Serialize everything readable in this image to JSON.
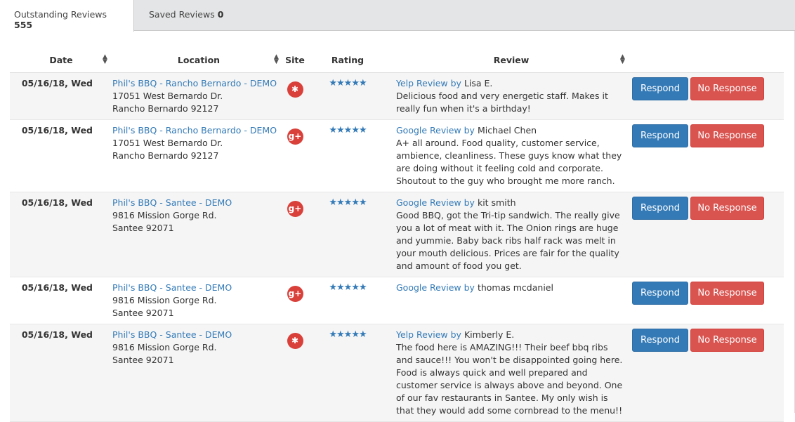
{
  "tabs": [
    {
      "label": "Outstanding Reviews",
      "count": "555"
    },
    {
      "label": "Saved Reviews",
      "count": "0"
    }
  ],
  "columns": {
    "date": "Date",
    "location": "Location",
    "site": "Site",
    "rating": "Rating",
    "review": "Review"
  },
  "buttons": {
    "respond": "Respond",
    "no_response": "No Response"
  },
  "reviews": [
    {
      "date": "05/16/18, Wed",
      "location_name": "Phil's BBQ - Rancho Bernardo - DEMO",
      "address1": "17051 West Bernardo Dr.",
      "address2": "Rancho Bernardo 92127",
      "site": "yelp",
      "rating": 5,
      "source_label": "Yelp Review by",
      "reviewer": "Lisa E.",
      "text": "Delicious food and very energetic staff. Makes it really fun when it's a birthday!"
    },
    {
      "date": "05/16/18, Wed",
      "location_name": "Phil's BBQ - Rancho Bernardo - DEMO",
      "address1": "17051 West Bernardo Dr.",
      "address2": "Rancho Bernardo 92127",
      "site": "google-plus",
      "rating": 5,
      "source_label": "Google Review by",
      "reviewer": "Michael Chen",
      "text": "A+ all around. Food quality, customer service, ambience, cleanliness. These guys know what they are doing without it feeling cold and corporate. Shoutout to the guy who brought me more ranch."
    },
    {
      "date": "05/16/18, Wed",
      "location_name": "Phil's BBQ - Santee - DEMO",
      "address1": "9816 Mission Gorge Rd.",
      "address2": "Santee 92071",
      "site": "google-plus",
      "rating": 5,
      "source_label": "Google Review by",
      "reviewer": "kit smith",
      "text": "Good BBQ, got the Tri-tip sandwich. The really give you a lot of meat with it. The Onion rings are huge and yummie. Baby back ribs half rack was melt in your mouth delicious. Prices are fair for the quality and amount of food you get."
    },
    {
      "date": "05/16/18, Wed",
      "location_name": "Phil's BBQ - Santee - DEMO",
      "address1": "9816 Mission Gorge Rd.",
      "address2": "Santee 92071",
      "site": "google-plus",
      "rating": 5,
      "source_label": "Google Review by",
      "reviewer": "thomas mcdaniel",
      "text": ""
    },
    {
      "date": "05/16/18, Wed",
      "location_name": "Phil's BBQ - Santee - DEMO",
      "address1": "9816 Mission Gorge Rd.",
      "address2": "Santee 92071",
      "site": "yelp",
      "rating": 5,
      "source_label": "Yelp Review by",
      "reviewer": "Kimberly E.",
      "text": "The food here is AMAZING!!! Their beef bbq ribs and sauce!!! You won't be disappointed going here. Food is always quick and well prepared and customer service is always above and beyond. One of our fav restaurants in Santee. My only wish is that they would add some cornbread to the menu!!"
    }
  ],
  "colors": {
    "link": "#337ab7",
    "respond": "#337ab7",
    "no_response": "#d9534f",
    "site_badge": "#d9403a"
  },
  "icons": {
    "yelp": "yelp-icon",
    "google-plus": "google-plus-icon",
    "star": "star-icon",
    "sort": "sort-icon"
  }
}
